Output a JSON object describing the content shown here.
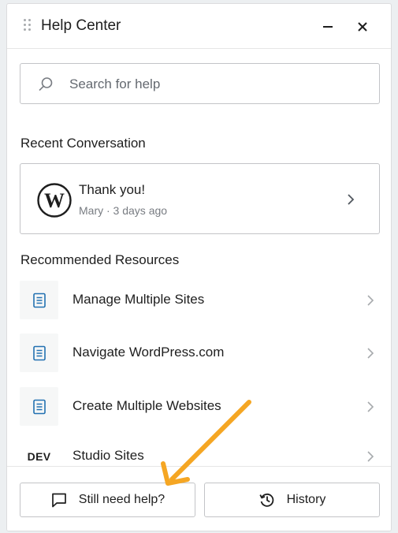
{
  "header": {
    "title": "Help Center",
    "minimize_icon": "minimize-icon",
    "close_icon": "close-icon"
  },
  "search": {
    "placeholder": "Search for help",
    "value": "",
    "icon": "search-icon"
  },
  "recent": {
    "section_title": "Recent Conversation",
    "conversation": {
      "title": "Thank you!",
      "meta": "Mary · 3 days ago",
      "avatar_icon": "wordpress-logo-icon"
    }
  },
  "resources": {
    "section_title": "Recommended Resources",
    "items": [
      {
        "label": "Manage Multiple Sites",
        "icon": "document-icon"
      },
      {
        "label": "Navigate WordPress.com",
        "icon": "document-icon"
      },
      {
        "label": "Create Multiple Websites",
        "icon": "document-icon"
      },
      {
        "label": "Studio Sites",
        "badge": "DEV"
      }
    ]
  },
  "footer": {
    "still_need_help_label": "Still need help?",
    "history_label": "History",
    "still_need_help_icon": "chat-bubble-icon",
    "history_icon": "history-icon"
  },
  "colors": {
    "accent_blue": "#2271b1",
    "arrow_orange": "#f5a623",
    "border": "#c3c4c7",
    "muted_text": "#787c82"
  },
  "annotation": {
    "arrow_icon": "annotation-arrow-icon"
  }
}
